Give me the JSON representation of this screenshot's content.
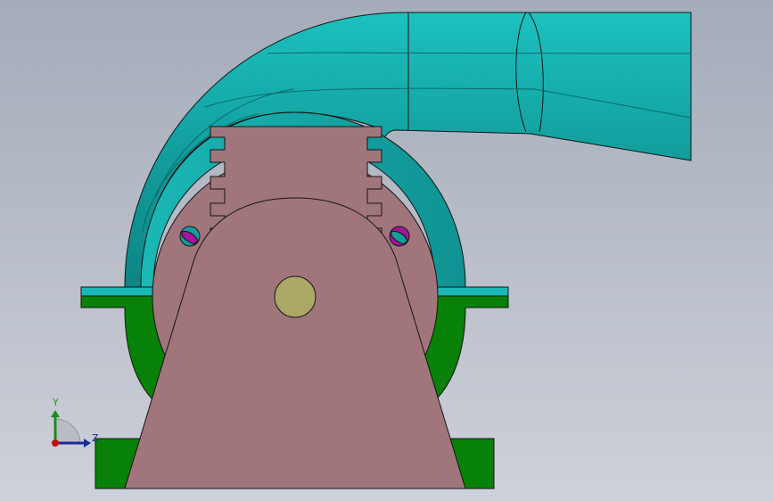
{
  "axes": {
    "y_label": "Y",
    "z_label": "Z"
  },
  "colors": {
    "background_top": "#a4abb9",
    "background_bottom": "#cdd1d9",
    "volute": "#139c9c",
    "volute_light": "#1cc1bf",
    "volute_dark": "#0e8a8a",
    "body": "#a0767c",
    "base": "#078107",
    "shaft": "#aba866",
    "bolt_head": "#a2169b",
    "outline": "#141414"
  }
}
